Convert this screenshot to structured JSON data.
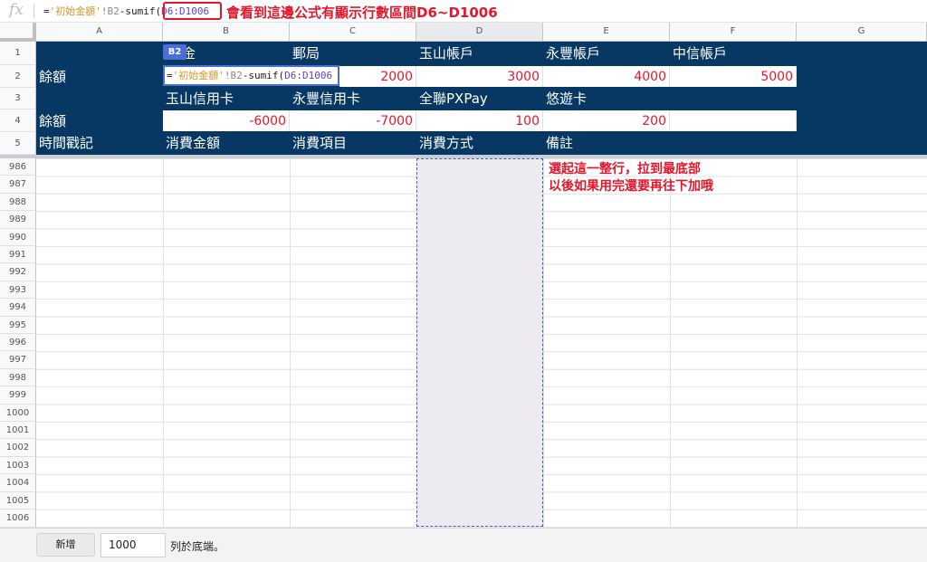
{
  "formula_bar": {
    "fx_label": "fx",
    "eq": "=",
    "str": "'初始金額'",
    "ref": "!B2",
    "fn": "-sumif(",
    "range": "D6:D1006",
    "annotation": "會看到這邊公式有顯示行數區間D6~D1006"
  },
  "columns": [
    "A",
    "B",
    "C",
    "D",
    "E",
    "F",
    "G"
  ],
  "frozen_rows": [
    "1",
    "2",
    "3",
    "4",
    "5"
  ],
  "sheet": {
    "row1": {
      "b": "金",
      "c": "郵局",
      "d": "玉山帳戶",
      "e": "永豐帳戶",
      "f": "中信帳戶"
    },
    "row2": {
      "a": "餘額",
      "b_formula": {
        "eq": "=",
        "str": "'初始金額'",
        "ref": "!B2",
        "fn": "-sumif(",
        "range": "D6:D1006"
      },
      "c": "2000",
      "d": "3000",
      "e": "4000",
      "f": "5000"
    },
    "row3": {
      "b": "玉山信用卡",
      "c": "永豐信用卡",
      "d": "全聯PXPay",
      "e": "悠遊卡"
    },
    "row4": {
      "a": "餘額",
      "b": "-6000",
      "c": "-7000",
      "d": "100",
      "e": "200"
    },
    "row5": {
      "a": "時間戳記",
      "b": "消費金額",
      "c": "消費項目",
      "d": "消費方式",
      "e": "備註"
    },
    "active_cell_tag": "B2"
  },
  "body_rows": [
    "986",
    "987",
    "988",
    "989",
    "990",
    "991",
    "992",
    "993",
    "994",
    "995",
    "996",
    "997",
    "998",
    "999",
    "1000",
    "1001",
    "1002",
    "1003",
    "1004",
    "1005",
    "1006"
  ],
  "annotation": {
    "line1": "選起這一整行，拉到最底部",
    "line2": "以後如果用完還要再往下加哦"
  },
  "footer": {
    "add_label": "新增",
    "count_value": "1000",
    "suffix_label": "列於底端。"
  },
  "colors": {
    "header_navy": "#073763",
    "annotation_red": "#e5162a",
    "selection_blue": "#4a6fd8"
  }
}
